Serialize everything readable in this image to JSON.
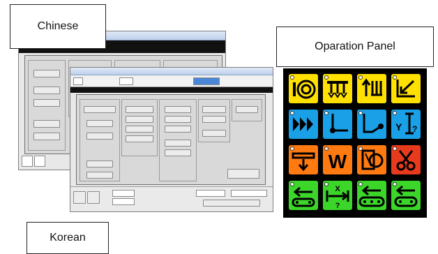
{
  "labels": {
    "chinese": "Chinese",
    "operation_panel": "Oparation Panel",
    "korean": "Korean"
  },
  "panel": {
    "keys": [
      {
        "icon": "drum-rolls-icon",
        "color": "#ffe000"
      },
      {
        "icon": "needle-bar-icon",
        "color": "#ffe000"
      },
      {
        "icon": "needle-select-icon",
        "color": "#ffe000"
      },
      {
        "icon": "diagonal-move-icon",
        "color": "#ffe000"
      },
      {
        "icon": "fast-forward-icon",
        "color": "#1aa0e6"
      },
      {
        "icon": "origin-point-icon",
        "color": "#1aa0e6"
      },
      {
        "icon": "return-point-icon",
        "color": "#1aa0e6"
      },
      {
        "icon": "height-adjust-icon",
        "color": "#1aa0e6"
      },
      {
        "icon": "tray-down-icon",
        "color": "#ff7a10"
      },
      {
        "icon": "w-letter-icon",
        "color": "#ff7a10"
      },
      {
        "icon": "thread-spool-icon",
        "color": "#ff7a10"
      },
      {
        "icon": "scissors-icon",
        "color": "#e83a1c"
      },
      {
        "icon": "feed-back-icon",
        "color": "#3cd62a"
      },
      {
        "icon": "distance-unknown-icon",
        "color": "#3cd62a"
      },
      {
        "icon": "feed-left-icon",
        "color": "#3cd62a"
      },
      {
        "icon": "feed-right-icon",
        "color": "#3cd62a"
      }
    ]
  }
}
